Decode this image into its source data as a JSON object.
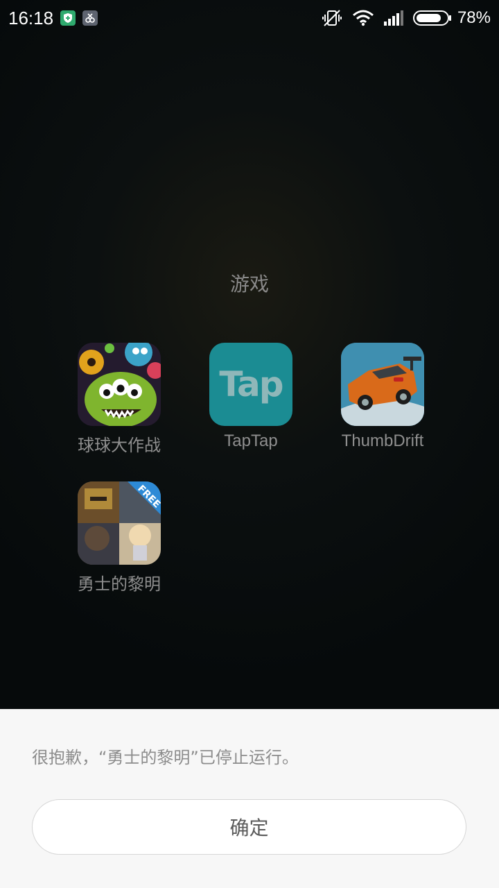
{
  "status_bar": {
    "time": "16:18",
    "battery": "78%"
  },
  "folder": {
    "title": "游戏",
    "apps": [
      {
        "label": "球球大作战"
      },
      {
        "label": "TapTap",
        "icon_text": "Tap"
      },
      {
        "label": "ThumbDrift"
      },
      {
        "label": "勇士的黎明",
        "badge": "FREE"
      }
    ]
  },
  "dialog": {
    "message": "很抱歉，“勇士的黎明”已停止运行。",
    "ok_label": "确定"
  },
  "colors": {
    "taptap": "#1b8c93",
    "dialog_bg": "#f7f7f7"
  }
}
